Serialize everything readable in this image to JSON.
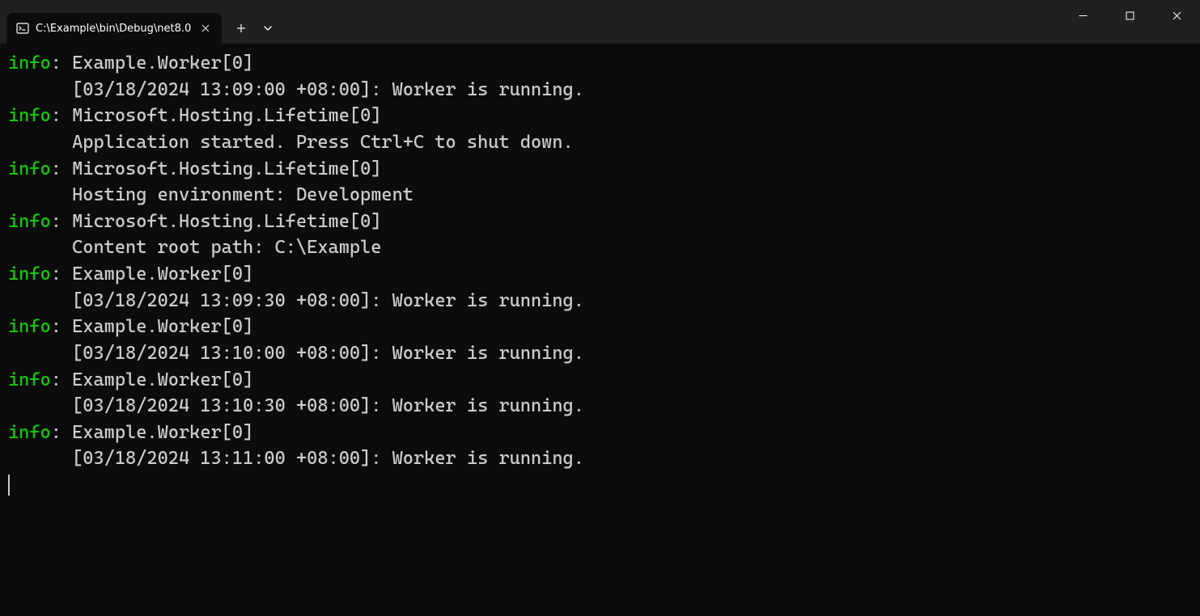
{
  "window": {
    "tabTitle": "C:\\Example\\bin\\Debug\\net8.0"
  },
  "colors": {
    "infoLevel": "#16c60c",
    "text": "#cccccc",
    "background": "#0c0c0c",
    "titlebar": "#202020"
  },
  "logLevelLabel": "info",
  "logSeparator": ": ",
  "logs": [
    {
      "level": "info",
      "category": "Example.Worker[0]",
      "message": "      [03/18/2024 13:09:00 +08:00]: Worker is running."
    },
    {
      "level": "info",
      "category": "Microsoft.Hosting.Lifetime[0]",
      "message": "      Application started. Press Ctrl+C to shut down."
    },
    {
      "level": "info",
      "category": "Microsoft.Hosting.Lifetime[0]",
      "message": "      Hosting environment: Development"
    },
    {
      "level": "info",
      "category": "Microsoft.Hosting.Lifetime[0]",
      "message": "      Content root path: C:\\Example"
    },
    {
      "level": "info",
      "category": "Example.Worker[0]",
      "message": "      [03/18/2024 13:09:30 +08:00]: Worker is running."
    },
    {
      "level": "info",
      "category": "Example.Worker[0]",
      "message": "      [03/18/2024 13:10:00 +08:00]: Worker is running."
    },
    {
      "level": "info",
      "category": "Example.Worker[0]",
      "message": "      [03/18/2024 13:10:30 +08:00]: Worker is running."
    },
    {
      "level": "info",
      "category": "Example.Worker[0]",
      "message": "      [03/18/2024 13:11:00 +08:00]: Worker is running."
    }
  ]
}
